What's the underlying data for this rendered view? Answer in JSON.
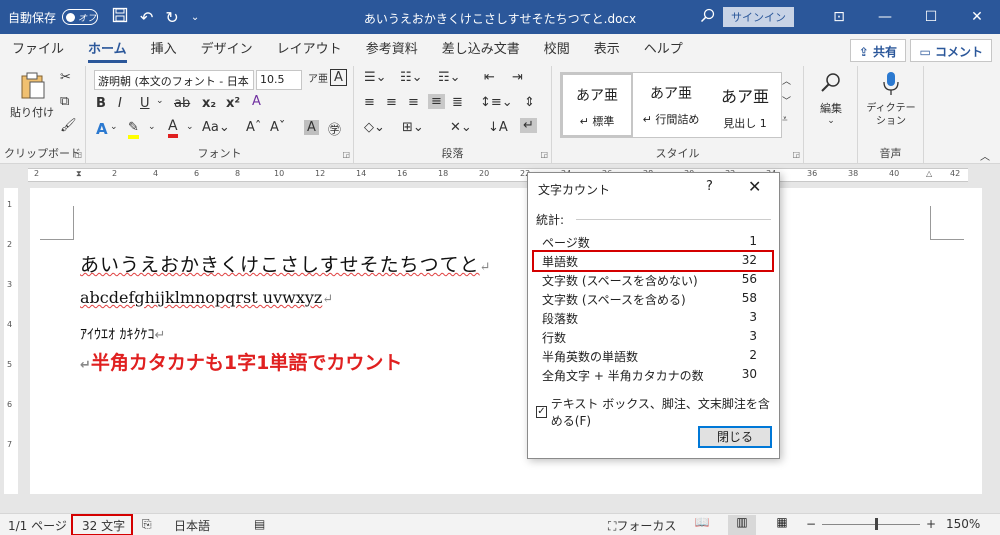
{
  "titlebar": {
    "autosave_label": "自動保存",
    "autosave_state": "オフ",
    "doc_title": "あいうえおかきくけこさしすせそたちつてと.docx",
    "signin": "サインイン",
    "accent": "#2b579a"
  },
  "tabs": [
    "ファイル",
    "ホーム",
    "挿入",
    "デザイン",
    "レイアウト",
    "参考資料",
    "差し込み文書",
    "校閲",
    "表示",
    "ヘルプ"
  ],
  "active_tab": "ホーム",
  "share_label": "共有",
  "comment_label": "コメント",
  "ribbon": {
    "clipboard": {
      "paste": "貼り付け",
      "label": "クリップボード"
    },
    "font": {
      "name": "游明朝 (本文のフォント - 日本",
      "size": "10.5",
      "label": "フォント"
    },
    "paragraph": {
      "label": "段落"
    },
    "styles": {
      "label": "スタイル",
      "items": [
        {
          "preview": "あア亜",
          "name": "↵ 標準"
        },
        {
          "preview": "あア亜",
          "name": "↵ 行間詰め"
        },
        {
          "preview": "あア亜",
          "name": "見出し 1"
        }
      ]
    },
    "editing": {
      "label": "編集"
    },
    "voice": {
      "dictate": "ディクテー\nション",
      "label": "音声"
    }
  },
  "ruler_numbers": [
    "2",
    "2",
    "4",
    "6",
    "8",
    "10",
    "12",
    "14",
    "16",
    "18",
    "20",
    "22",
    "24",
    "26",
    "28",
    "30",
    "32",
    "34",
    "36",
    "38",
    "40",
    "42"
  ],
  "vruler_numbers": [
    "1",
    "2",
    "3",
    "4",
    "5",
    "6",
    "7"
  ],
  "document": {
    "line1": "あいうえおかきくけこさしすせそたちつてと",
    "line2": "abcdefghijklmnopqrst uvwxyz",
    "line3": "ｱｲｳｴｵ ｶｷｸｹｺ",
    "line4": "半角カタカナも1字1単語でカウント",
    "para_mark": "↵"
  },
  "dialog": {
    "title": "文字カウント",
    "help": "?",
    "section": "統計:",
    "stats": [
      {
        "label": "ページ数",
        "value": "1"
      },
      {
        "label": "単語数",
        "value": "32"
      },
      {
        "label": "文字数 (スペースを含めない)",
        "value": "56"
      },
      {
        "label": "文字数 (スペースを含める)",
        "value": "58"
      },
      {
        "label": "段落数",
        "value": "3"
      },
      {
        "label": "行数",
        "value": "3"
      },
      {
        "label": "半角英数の単語数",
        "value": "2"
      },
      {
        "label": "全角文字 + 半角カタカナの数",
        "value": "30"
      }
    ],
    "checkbox_label": "テキスト ボックス、脚注、文末脚注を含める(F)",
    "checkbox_checked": true,
    "close_button": "閉じる",
    "highlight_color": "#d40000"
  },
  "statusbar": {
    "page": "1/1 ページ",
    "words": "32 文字",
    "language": "日本語",
    "focus": "フォーカス",
    "zoom": "150%",
    "zoom_minus": "−",
    "zoom_plus": "+"
  }
}
